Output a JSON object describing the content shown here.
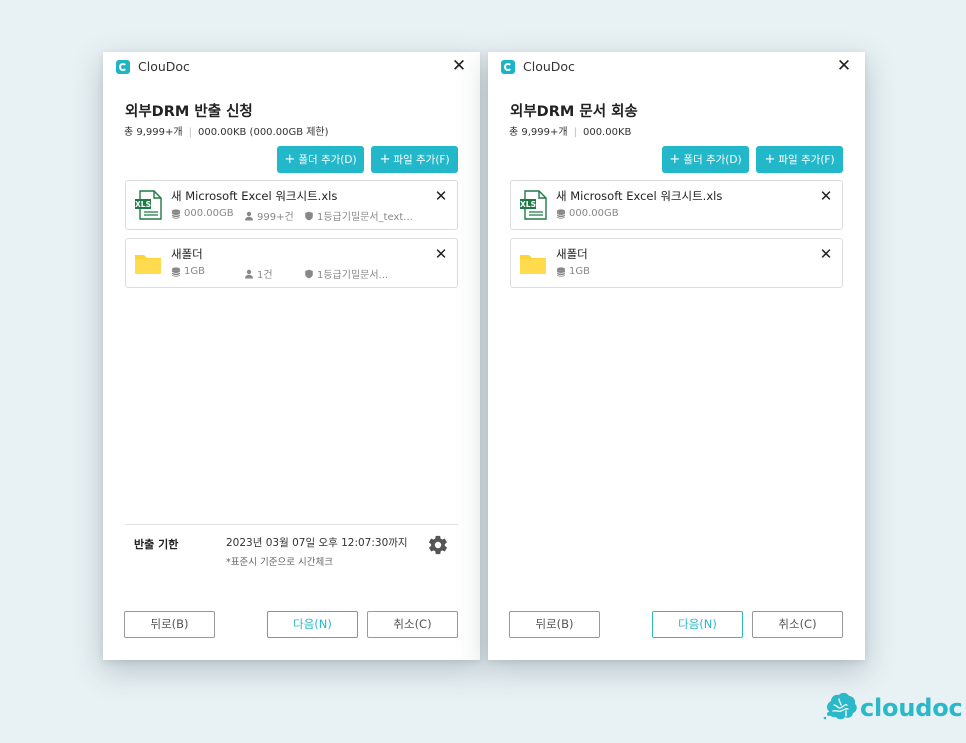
{
  "colors": {
    "accent": "#22b8c9",
    "folder": "#ffd43b",
    "excel": "#1f7a45"
  },
  "export_dialog": {
    "app_name": "ClouDoc",
    "heading": "외부DRM 반출 신청",
    "summary": {
      "count": "총 9,999+개",
      "size": "000.00KB (000.00GB 제한)"
    },
    "add_folder": "폴더 추가(D)",
    "add_file": "파일 추가(F)",
    "items": [
      {
        "icon": "excel-file-icon",
        "name": "새 Microsoft Excel 워크시트.xls",
        "size": "000.00GB",
        "users": "999+건",
        "security": "1등급기밀문서_text..."
      },
      {
        "icon": "folder-icon",
        "name": "새폴더",
        "size": "1GB",
        "users": "1건",
        "security": "1등급기밀문서..."
      }
    ],
    "deadline": {
      "label": "반출 기한",
      "value": "2023년 03월 07일  오후 12:07:30까지",
      "note": "*표준시 기준으로 시간체크"
    },
    "buttons": {
      "back": "뒤로(B)",
      "next": "다음(N)",
      "cancel": "취소(C)"
    }
  },
  "return_dialog": {
    "app_name": "ClouDoc",
    "heading": "외부DRM 문서 회송",
    "summary": {
      "count": "총 9,999+개",
      "size": "000.00KB"
    },
    "add_folder": "폴더 추가(D)",
    "add_file": "파일 추가(F)",
    "items": [
      {
        "icon": "excel-file-icon",
        "name": "새 Microsoft Excel 워크시트.xls",
        "size": "000.00GB"
      },
      {
        "icon": "folder-icon",
        "name": "새폴더",
        "size": "1GB"
      }
    ],
    "buttons": {
      "back": "뒤로(B)",
      "next": "다음(N)",
      "cancel": "취소(C)"
    }
  },
  "brand": {
    "name": "cloudoc"
  }
}
